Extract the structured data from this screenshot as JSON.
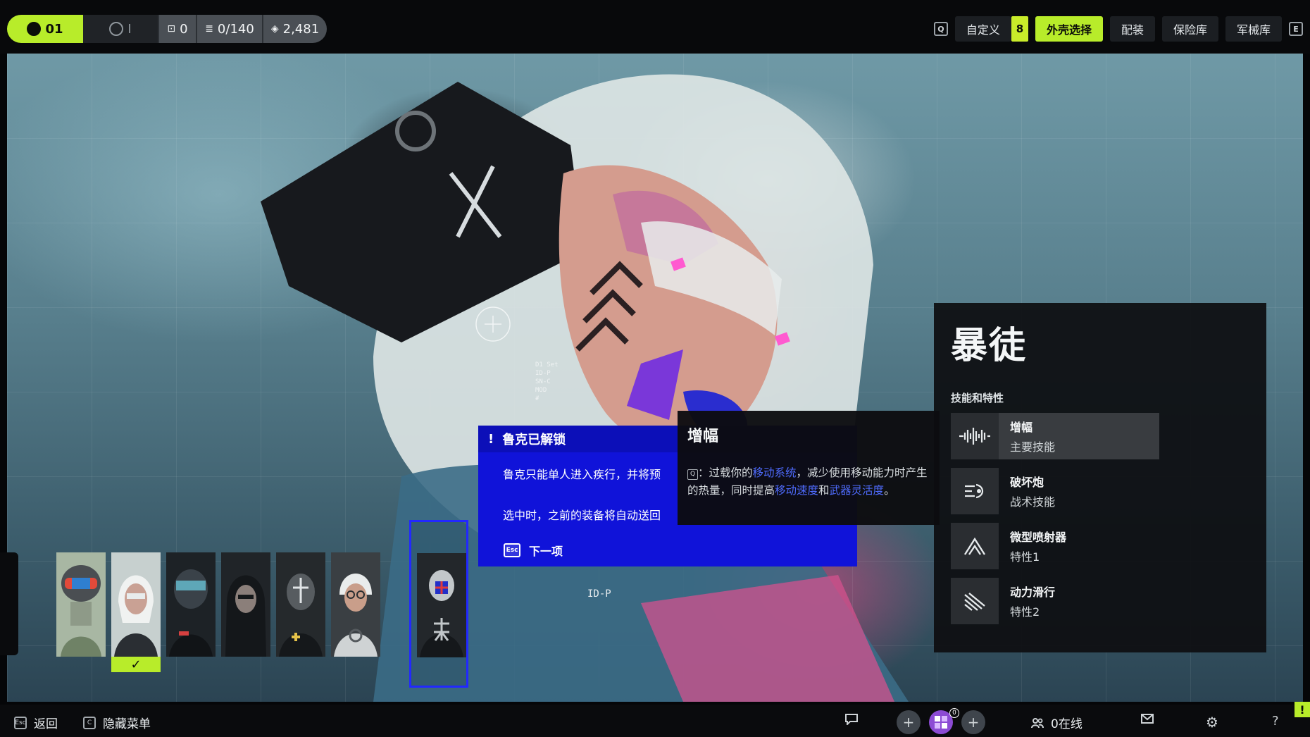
{
  "topbar": {
    "player_slot": "01",
    "second_slot": "I",
    "counter_a": "0",
    "counter_b": "0/140",
    "currency": "2,481",
    "nav_key_left": "Q",
    "nav_key_right": "E",
    "nav": [
      {
        "label": "自定义",
        "badge": "8",
        "active": false
      },
      {
        "label": "外壳选择",
        "active": true
      },
      {
        "label": "配装",
        "active": false
      },
      {
        "label": "保险库",
        "active": false
      },
      {
        "label": "军械库",
        "active": false
      }
    ]
  },
  "loadout": {
    "title": "暴徒",
    "section_label": "技能和特性",
    "abilities": [
      {
        "name": "增幅",
        "type": "主要技能",
        "icon": "soundwave-icon",
        "selected": true
      },
      {
        "name": "破坏炮",
        "type": "战术技能",
        "icon": "blast-cannon-icon",
        "selected": false
      },
      {
        "name": "微型喷射器",
        "type": "特性1",
        "icon": "jet-chevron-icon",
        "selected": false
      },
      {
        "name": "动力滑行",
        "type": "特性2",
        "icon": "slide-lines-icon",
        "selected": false
      }
    ]
  },
  "tooltip": {
    "title": "增幅",
    "key": "Q",
    "parts": [
      "：过载你的",
      "移动系统",
      "，减少使用移动能力时产生的热量，同时提高",
      "移动速度",
      "和",
      "武器灵活度",
      "。"
    ],
    "highlight_color": "#4f6cff"
  },
  "modal": {
    "title": "鲁克已解锁",
    "line1": "鲁克只能单人进入疾行，并将预",
    "line2": "选中时，之前的装备将自动送回",
    "esc_key": "Esc",
    "next_label": "下一项",
    "bg_color": "#1013d9"
  },
  "hero": {
    "id_label": "ID-P",
    "hud_lines": [
      "D1 Set",
      "ID-P",
      "SN-C",
      "MOD",
      "#"
    ]
  },
  "roster": {
    "selected_check": "✓",
    "characters": [
      {
        "icon": "helmet-red-portrait-icon",
        "selected": false
      },
      {
        "icon": "white-hair-portrait-icon",
        "selected": true
      },
      {
        "icon": "visor-dark-portrait-icon",
        "selected": false
      },
      {
        "icon": "hooded-portrait-icon",
        "selected": false
      },
      {
        "icon": "cross-mask-portrait-icon",
        "selected": false
      },
      {
        "icon": "goggles-portrait-icon",
        "selected": false
      }
    ],
    "new_unlock": {
      "icon": "rook-portrait-icon"
    }
  },
  "bottombar": {
    "back_key": "Esc",
    "back_label": "返回",
    "hide_key": "C",
    "hide_label": "隐藏菜单",
    "online_label": "0在线",
    "party_count": "0",
    "alert": "!"
  },
  "colors": {
    "accent": "#b8ec2a",
    "modal_blue": "#1013d9",
    "link_blue": "#4f6cff"
  }
}
